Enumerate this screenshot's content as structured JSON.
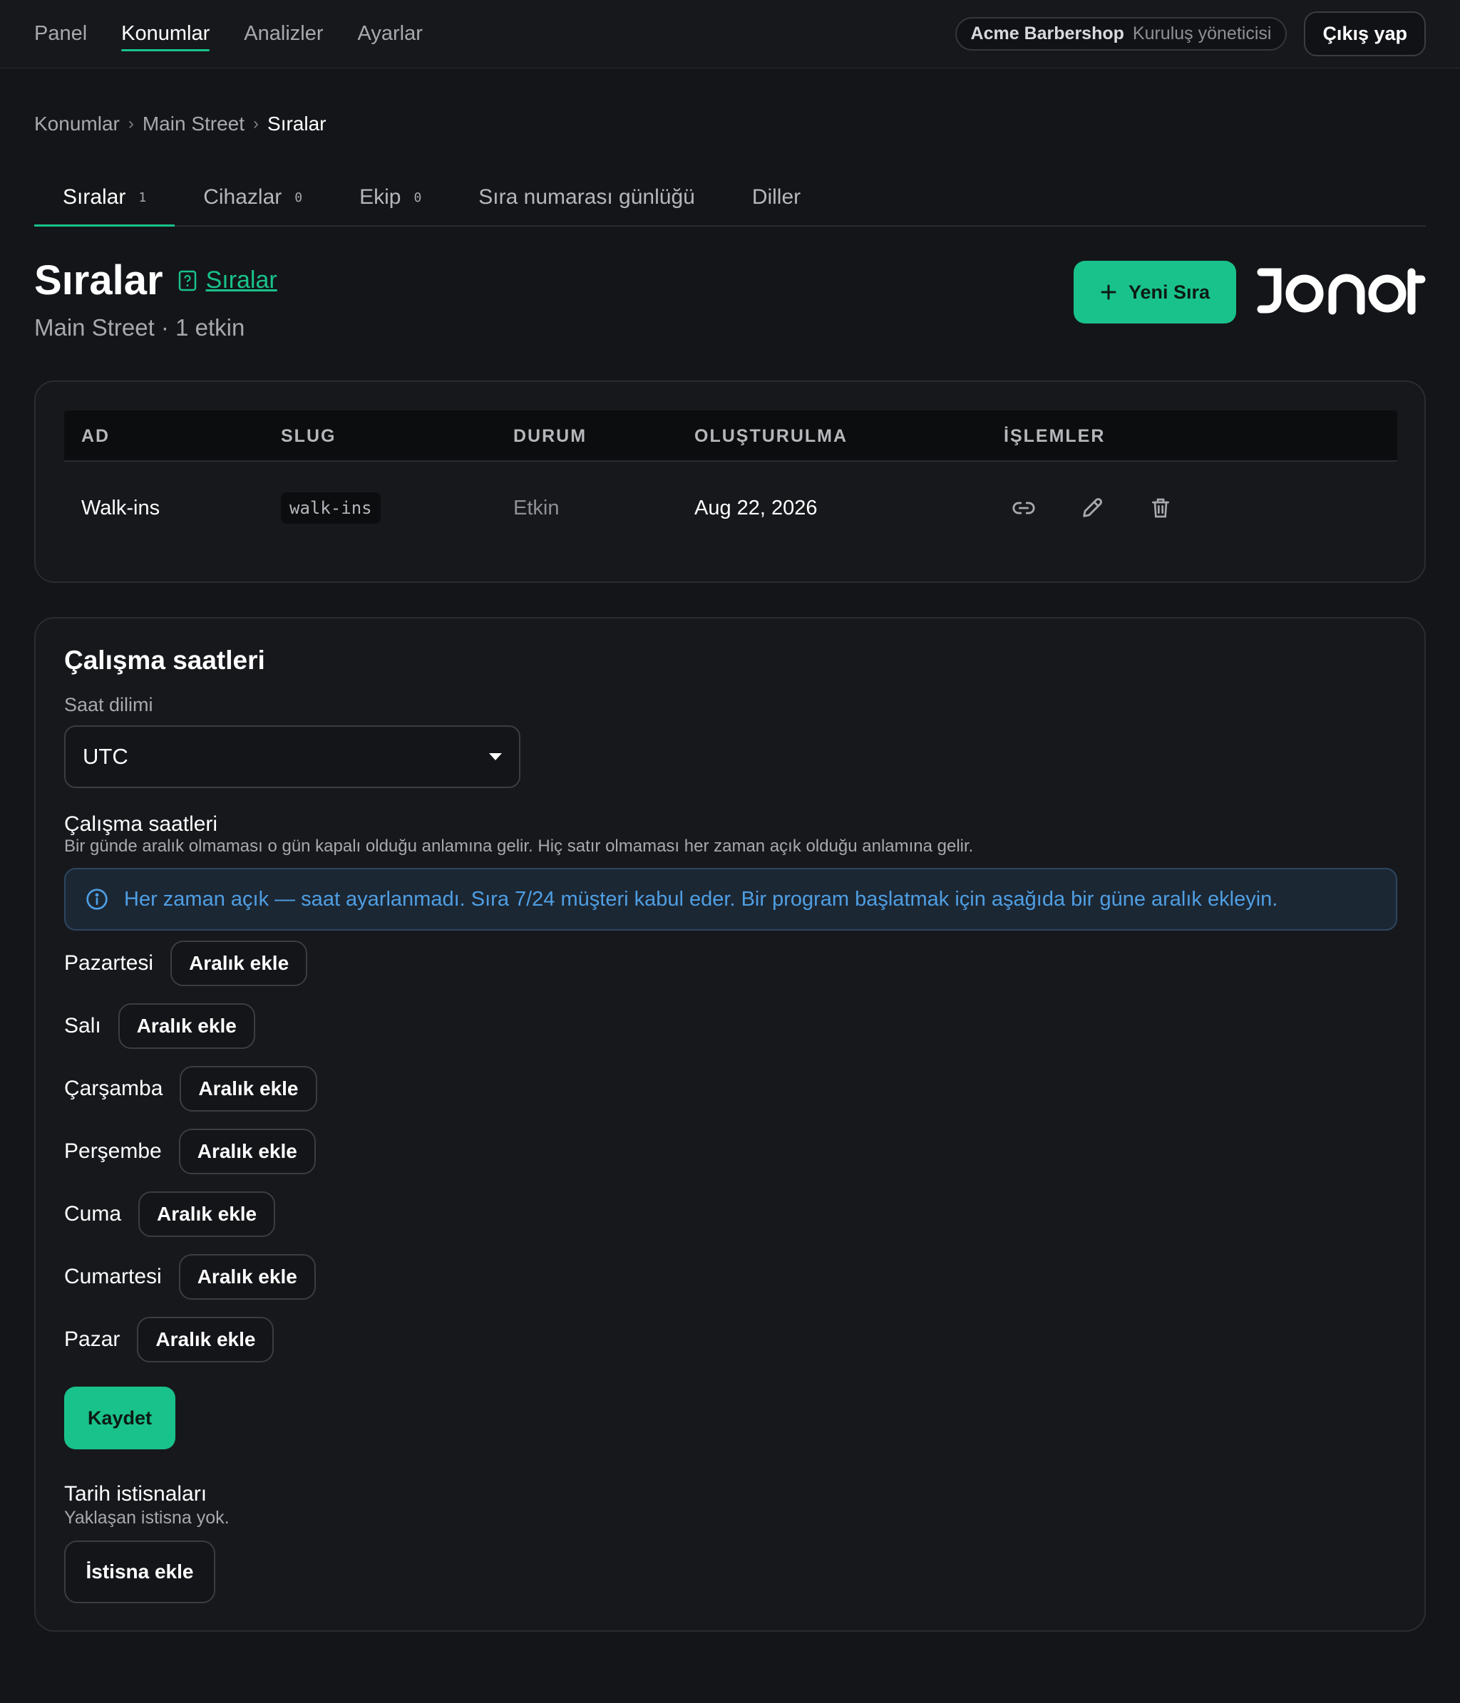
{
  "nav": {
    "items": [
      {
        "label": "Panel"
      },
      {
        "label": "Konumlar"
      },
      {
        "label": "Analizler"
      },
      {
        "label": "Ayarlar"
      }
    ],
    "org_name": "Acme Barbershop",
    "org_role": "Kuruluş yöneticisi",
    "logout_label": "Çıkış yap"
  },
  "breadcrumb": [
    "Konumlar",
    "Main Street",
    "Sıralar"
  ],
  "tabs": [
    {
      "label": "Sıralar",
      "count": "1"
    },
    {
      "label": "Cihazlar",
      "count": "0"
    },
    {
      "label": "Ekip",
      "count": "0"
    },
    {
      "label": "Sıra numarası günlüğü"
    },
    {
      "label": "Diller"
    }
  ],
  "header": {
    "title": "Sıralar",
    "help_link": "Sıralar",
    "subtitle": "Main Street · 1 etkin",
    "new_button": "Yeni Sıra",
    "brand": "JONOT"
  },
  "table": {
    "columns": [
      "AD",
      "SLUG",
      "DURUM",
      "OLUŞTURULMA",
      "İŞLEMLER"
    ],
    "rows": [
      {
        "name": "Walk-ins",
        "slug": "walk-ins",
        "status": "Etkin",
        "created": "Aug 22, 2026"
      }
    ]
  },
  "hours": {
    "title": "Çalışma saatleri",
    "timezone_label": "Saat dilimi",
    "timezone_value": "UTC",
    "schedule_title": "Çalışma saatleri",
    "schedule_desc": "Bir günde aralık olmaması o gün kapalı olduğu anlamına gelir. Hiç satır olmaması her zaman açık olduğu anlamına gelir.",
    "alert": "Her zaman açık — saat ayarlanmadı. Sıra 7/24 müşteri kabul eder. Bir program başlatmak için aşağıda bir güne aralık ekleyin.",
    "days": [
      "Pazartesi",
      "Salı",
      "Çarşamba",
      "Perşembe",
      "Cuma",
      "Cumartesi",
      "Pazar"
    ],
    "add_range_label": "Aralık ekle",
    "save_label": "Kaydet",
    "exceptions_title": "Tarih istisnaları",
    "exceptions_desc": "Yaklaşan istisna yok.",
    "add_exception_label": "İstisna ekle"
  },
  "colors": {
    "accent": "#19c28a",
    "background": "#141518",
    "alert_text": "#4f9fe3"
  }
}
